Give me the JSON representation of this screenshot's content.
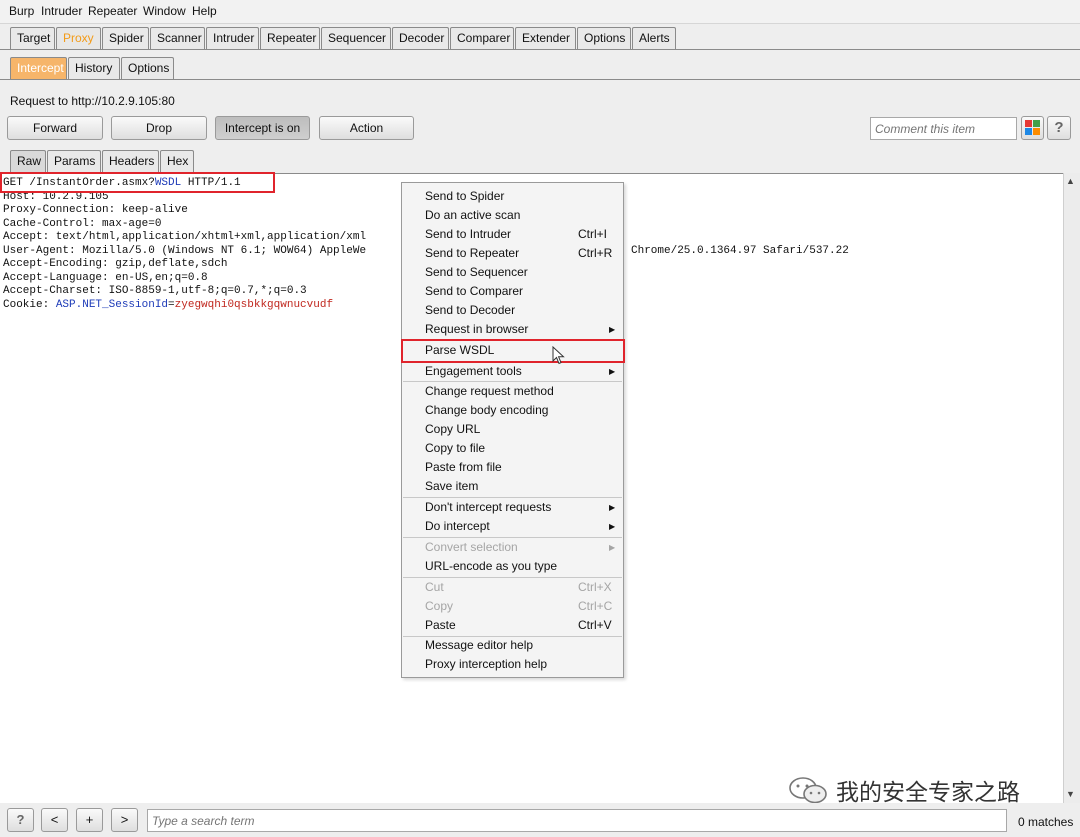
{
  "menubar": [
    "Burp",
    "Intruder",
    "Repeater",
    "Window",
    "Help"
  ],
  "main_tabs": [
    "Target",
    "Proxy",
    "Spider",
    "Scanner",
    "Intruder",
    "Repeater",
    "Sequencer",
    "Decoder",
    "Comparer",
    "Extender",
    "Options",
    "Alerts"
  ],
  "main_tabs_active": "Proxy",
  "proxy_tabs": [
    "Intercept",
    "History",
    "Options"
  ],
  "proxy_tabs_active": "Intercept",
  "intercept": {
    "request_label": "Request to http://10.2.9.105:80",
    "forward": "Forward",
    "drop": "Drop",
    "intercept_toggle": "Intercept is on",
    "action": "Action",
    "comment_placeholder": "Comment this item",
    "help": "?"
  },
  "editor_tabs": [
    "Raw",
    "Params",
    "Headers",
    "Hex"
  ],
  "editor_tabs_active": "Raw",
  "request": {
    "line1_a": "GET /InstantOrder.asmx?",
    "line1_b": "WSDL",
    "line1_c": " HTTP/1.1",
    "host": "Host: 10.2.9.105",
    "proxy_conn": "Proxy-Connection: keep-alive",
    "cache": "Cache-Control: max-age=0",
    "accept": "Accept: text/html,application/xhtml+xml,application/xml",
    "ua_a": "User-Agent: Mozilla/5.0 (Windows NT 6.1; WOW64) AppleWe",
    "ua_b": "Chrome/25.0.1364.97 Safari/537.22",
    "enc": "Accept-Encoding: gzip,deflate,sdch",
    "lang": "Accept-Language: en-US,en;q=0.8",
    "charset": "Accept-Charset: ISO-8859-1,utf-8;q=0.7,*;q=0.3",
    "cookie_a": "Cookie: ",
    "cookie_name": "ASP.NET_SessionId",
    "cookie_eq": "=",
    "cookie_val": "zyegwqhi0qsbkkgqwnucvudf"
  },
  "context_menu": {
    "send_spider": "Send to Spider",
    "active_scan": "Do an active scan",
    "send_intruder": "Send to Intruder",
    "send_intruder_sc": "Ctrl+I",
    "send_repeater": "Send to Repeater",
    "send_repeater_sc": "Ctrl+R",
    "send_sequencer": "Send to Sequencer",
    "send_comparer": "Send to Comparer",
    "send_decoder": "Send to Decoder",
    "request_browser": "Request in browser",
    "parse_wsdl": "Parse WSDL",
    "engagement": "Engagement tools",
    "change_method": "Change request method",
    "change_encoding": "Change body encoding",
    "copy_url": "Copy URL",
    "copy_file": "Copy to file",
    "paste_file": "Paste from file",
    "save_item": "Save item",
    "dont_intercept": "Don't intercept requests",
    "do_intercept": "Do intercept",
    "convert_sel": "Convert selection",
    "url_encode": "URL-encode as you type",
    "cut": "Cut",
    "cut_sc": "Ctrl+X",
    "copy": "Copy",
    "copy_sc": "Ctrl+C",
    "paste": "Paste",
    "paste_sc": "Ctrl+V",
    "editor_help": "Message editor help",
    "proxy_help": "Proxy interception help"
  },
  "bottom": {
    "help": "?",
    "prev": "<",
    "add": "+",
    "next": ">",
    "search_placeholder": "Type a search term",
    "matches": "0 matches"
  },
  "watermark": "我的安全专家之路",
  "colors": {
    "active_tab_text": "#f39b18",
    "sub_active_tab_bg": "#f6b56a",
    "highlight_box": "#e0242c",
    "wsdl_text": "#1f3cb8",
    "cookie_value": "#c0281f"
  }
}
